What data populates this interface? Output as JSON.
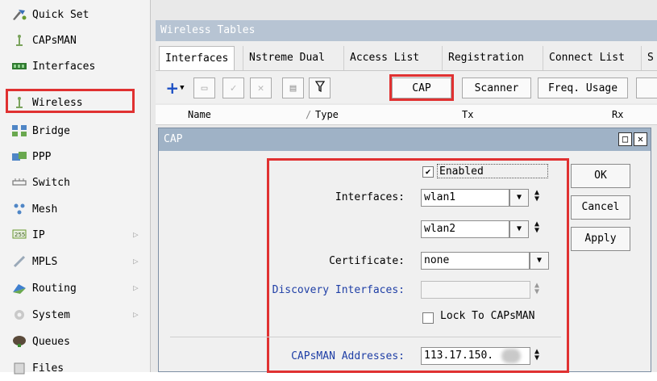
{
  "sidebar": {
    "items": [
      {
        "label": "Quick Set",
        "icon": "quick-set-icon"
      },
      {
        "label": "CAPsMAN",
        "icon": "capsman-icon"
      },
      {
        "label": "Interfaces",
        "icon": "interfaces-icon"
      },
      {
        "label": "Wireless",
        "icon": "wireless-icon"
      },
      {
        "label": "Bridge",
        "icon": "bridge-icon"
      },
      {
        "label": "PPP",
        "icon": "ppp-icon"
      },
      {
        "label": "Switch",
        "icon": "switch-icon"
      },
      {
        "label": "Mesh",
        "icon": "mesh-icon"
      },
      {
        "label": "IP",
        "icon": "ip-icon"
      },
      {
        "label": "MPLS",
        "icon": "mpls-icon"
      },
      {
        "label": "Routing",
        "icon": "routing-icon"
      },
      {
        "label": "System",
        "icon": "system-icon"
      },
      {
        "label": "Queues",
        "icon": "queues-icon"
      },
      {
        "label": "Files",
        "icon": "files-icon"
      }
    ]
  },
  "window": {
    "title": "Wireless Tables",
    "tabs": [
      "Interfaces",
      "Nstreme Dual",
      "Access List",
      "Registration",
      "Connect List",
      "S"
    ],
    "toolbar": {
      "cap_label": "CAP",
      "scanner_label": "Scanner",
      "freq_usage_label": "Freq. Usage"
    },
    "columns": [
      "Name",
      "Type",
      "Tx",
      "Rx"
    ],
    "sort_marker": "/"
  },
  "dialog": {
    "title": "CAP",
    "enabled_label": "Enabled",
    "enabled_checked": "✔",
    "interfaces_label": "Interfaces:",
    "interface_1": "wlan1",
    "interface_2": "wlan2",
    "certificate_label": "Certificate:",
    "certificate_value": "none",
    "discovery_label": "Discovery Interfaces:",
    "lock_label": "Lock To CAPsMAN",
    "capsman_addresses_label": "CAPsMAN Addresses:",
    "capsman_address_value": "113.17.150.",
    "ok_label": "OK",
    "cancel_label": "Cancel",
    "apply_label": "Apply"
  },
  "colors": {
    "highlight": "#e03131",
    "window_title": "#b7c4d3",
    "dialog_title": "#9fb2c6",
    "blue_label": "#1f3fa6"
  }
}
